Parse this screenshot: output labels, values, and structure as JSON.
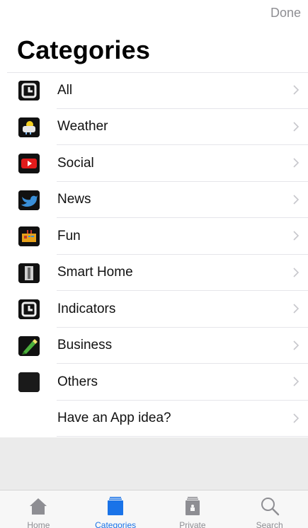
{
  "header": {
    "done_label": "Done",
    "title": "Categories"
  },
  "categories": [
    {
      "label": "All",
      "icon": "clock-app-icon"
    },
    {
      "label": "Weather",
      "icon": "weather-app-icon"
    },
    {
      "label": "Social",
      "icon": "youtube-app-icon"
    },
    {
      "label": "News",
      "icon": "twitter-bird-icon"
    },
    {
      "label": "Fun",
      "icon": "fun-app-icon"
    },
    {
      "label": "Smart Home",
      "icon": "smart-home-app-icon"
    },
    {
      "label": "Indicators",
      "icon": "indicators-app-icon"
    },
    {
      "label": "Business",
      "icon": "business-app-icon"
    },
    {
      "label": "Others",
      "icon": "others-app-icon"
    },
    {
      "label": "Have an App idea?",
      "icon": ""
    }
  ],
  "tabbar": {
    "tabs": [
      {
        "label": "Home",
        "icon": "home-icon",
        "active": false
      },
      {
        "label": "Categories",
        "icon": "categories-icon",
        "active": true
      },
      {
        "label": "Private",
        "icon": "private-icon",
        "active": false
      },
      {
        "label": "Search",
        "icon": "search-icon",
        "active": false
      }
    ]
  },
  "colors": {
    "accent": "#1a73e8",
    "inactive": "#8e8e93",
    "separator": "#e5e5ea"
  }
}
